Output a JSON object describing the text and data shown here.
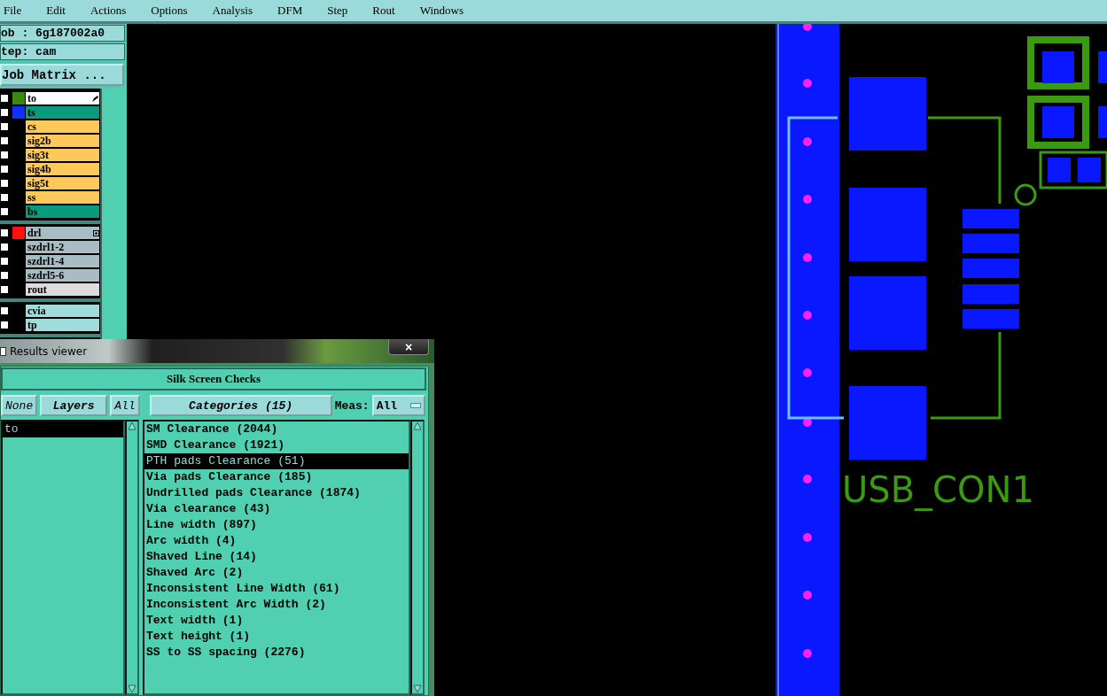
{
  "menu": [
    "File",
    "Edit",
    "Actions",
    "Options",
    "Analysis",
    "DFM",
    "Step",
    "Rout",
    "Windows"
  ],
  "job": {
    "job_line": "ob : 6g187002a0",
    "step_line": "tep: cam",
    "matrix_button": "Job Matrix ..."
  },
  "layers": [
    {
      "group": [
        {
          "name": "to",
          "kind": "board",
          "color": "#3a8a10",
          "checked": false,
          "editing": true
        },
        {
          "name": "ts",
          "kind": "mask",
          "color": "#1030ff",
          "checked": false
        },
        {
          "name": "cs",
          "kind": "signal",
          "checked": false
        },
        {
          "name": "sig2b",
          "kind": "signal",
          "checked": false
        },
        {
          "name": "sig3t",
          "kind": "signal",
          "checked": false
        },
        {
          "name": "sig4b",
          "kind": "signal",
          "checked": false
        },
        {
          "name": "sig5t",
          "kind": "signal",
          "checked": false
        },
        {
          "name": "ss",
          "kind": "signal",
          "checked": false
        },
        {
          "name": "bs",
          "kind": "mask",
          "checked": false
        }
      ]
    },
    {
      "group": [
        {
          "name": "drl",
          "kind": "drill",
          "color": "#ff1010",
          "checked": false,
          "expandable": true
        },
        {
          "name": "szdrl1-2",
          "kind": "drill",
          "checked": false
        },
        {
          "name": "szdrl1-4",
          "kind": "drill",
          "checked": false
        },
        {
          "name": "szdrl5-6",
          "kind": "drill",
          "checked": false
        },
        {
          "name": "rout",
          "kind": "rout",
          "checked": false
        }
      ]
    },
    {
      "group": [
        {
          "name": "cvia",
          "kind": "misc",
          "checked": false
        },
        {
          "name": "tp",
          "kind": "misc",
          "checked": false
        }
      ]
    }
  ],
  "canvas": {
    "labels": [
      "USB_CON1"
    ]
  },
  "results_viewer": {
    "title": "Results viewer",
    "close": "×",
    "heading": "Silk Screen Checks",
    "layer_buttons": [
      "None",
      "Layers",
      "All"
    ],
    "categories_button": "Categories (15)",
    "meas_label": "Meas:",
    "meas_value": "All",
    "layers_list": [
      {
        "name": "to",
        "selected": true
      }
    ],
    "categories": [
      {
        "name": "SM Clearance (2044)",
        "selected": false
      },
      {
        "name": "SMD Clearance (1921)",
        "selected": false
      },
      {
        "name": "PTH pads Clearance (51)",
        "selected": true
      },
      {
        "name": "Via pads Clearance (185)",
        "selected": false
      },
      {
        "name": "Undrilled pads Clearance (1874)",
        "selected": false
      },
      {
        "name": "Via clearance (43)",
        "selected": false
      },
      {
        "name": "Line width (897)",
        "selected": false
      },
      {
        "name": "Arc width (4)",
        "selected": false
      },
      {
        "name": "Shaved Line (14)",
        "selected": false
      },
      {
        "name": "Shaved Arc (2)",
        "selected": false
      },
      {
        "name": "Inconsistent Line Width (61)",
        "selected": false
      },
      {
        "name": "Inconsistent Arc Width (2)",
        "selected": false
      },
      {
        "name": "Text width (1)",
        "selected": false
      },
      {
        "name": "Text height (1)",
        "selected": false
      },
      {
        "name": "SS to SS spacing (2276)",
        "selected": false
      }
    ]
  }
}
